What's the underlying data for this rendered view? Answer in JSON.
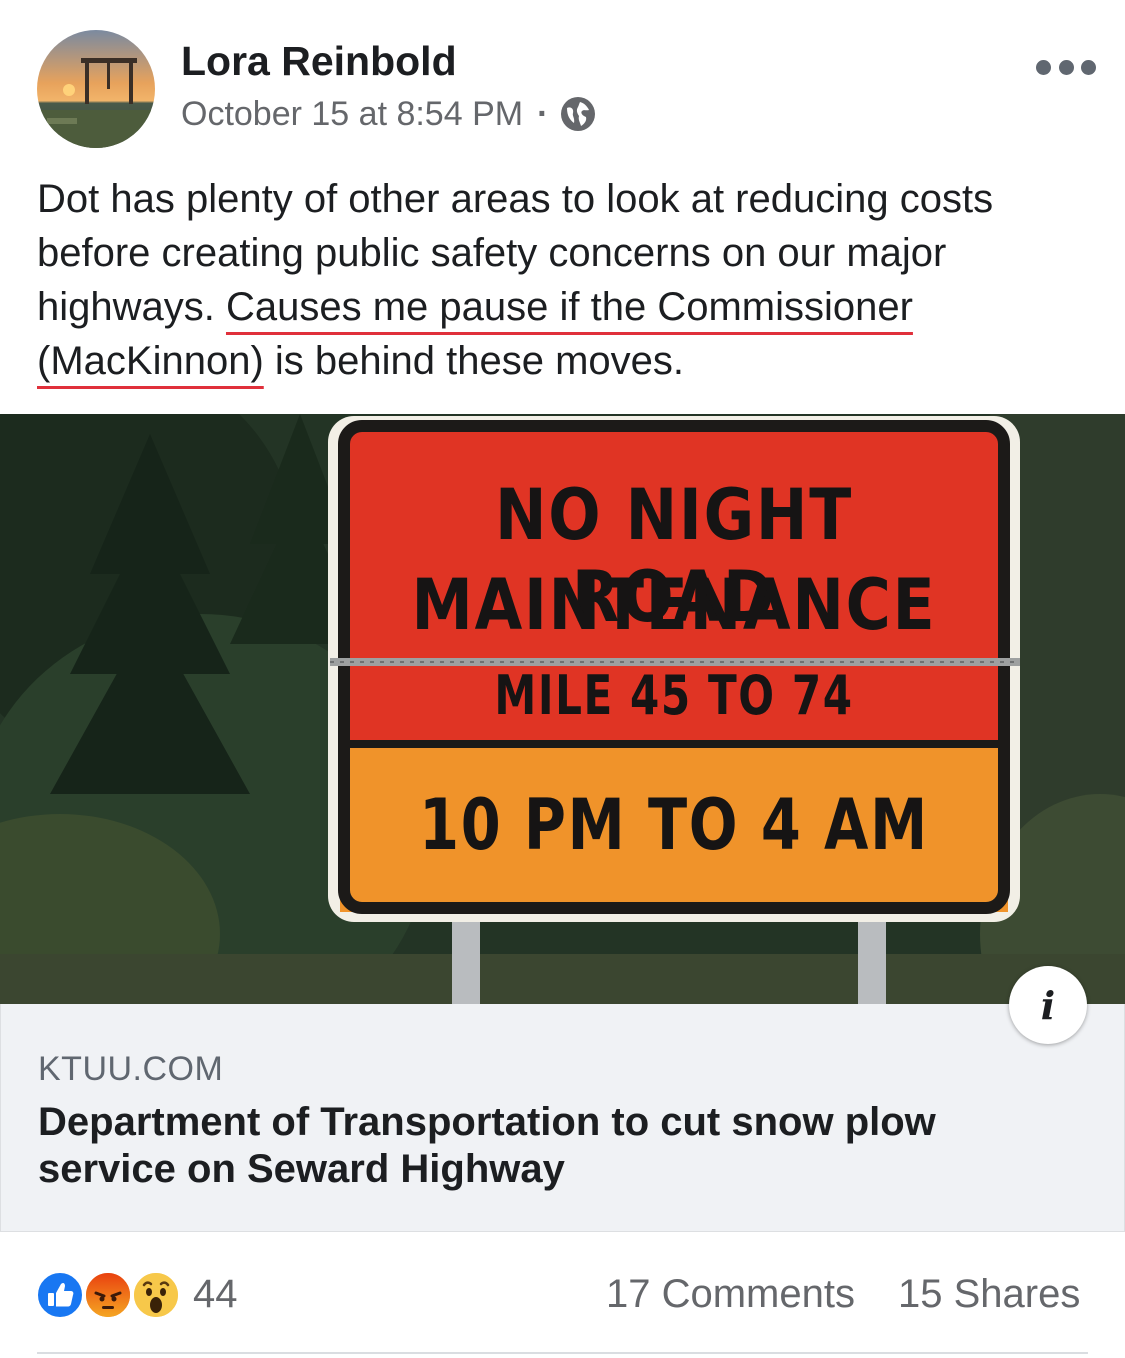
{
  "post": {
    "author": "Lora Reinbold",
    "timestamp": "October 15 at 8:54 PM",
    "separator": "·",
    "audience_icon": "globe-icon",
    "more_icon": "more-dots-icon",
    "text_plain": "Dot has plenty of other areas to look at reducing costs before creating public safety concerns on our major highways. ",
    "text_underlined": "Causes me pause if the Commissioner (MacKinnon)",
    "text_tail": " is behind these moves."
  },
  "link_preview": {
    "sign": {
      "line1": "NO NIGHT ROAD",
      "line2": "MAINTENANCE",
      "line3": "MILE 45 TO 74",
      "line4": "10 PM TO 4 AM"
    },
    "info_label": "i",
    "domain": "KTUU.COM",
    "title": "Department of Transportation to cut snow plow service on Seward Highway"
  },
  "footer": {
    "reaction_icons": [
      "like-icon",
      "angry-icon",
      "wow-icon"
    ],
    "reaction_count": "44",
    "comments": "17 Comments",
    "shares": "15 Shares"
  },
  "colors": {
    "text_primary": "#1c1e21",
    "text_secondary": "#65676b",
    "highlight_underline": "#e0303b",
    "like_blue": "#1877f2",
    "sign_red": "#e03424",
    "sign_orange": "#f0932a",
    "caption_bg": "#f0f2f5"
  }
}
